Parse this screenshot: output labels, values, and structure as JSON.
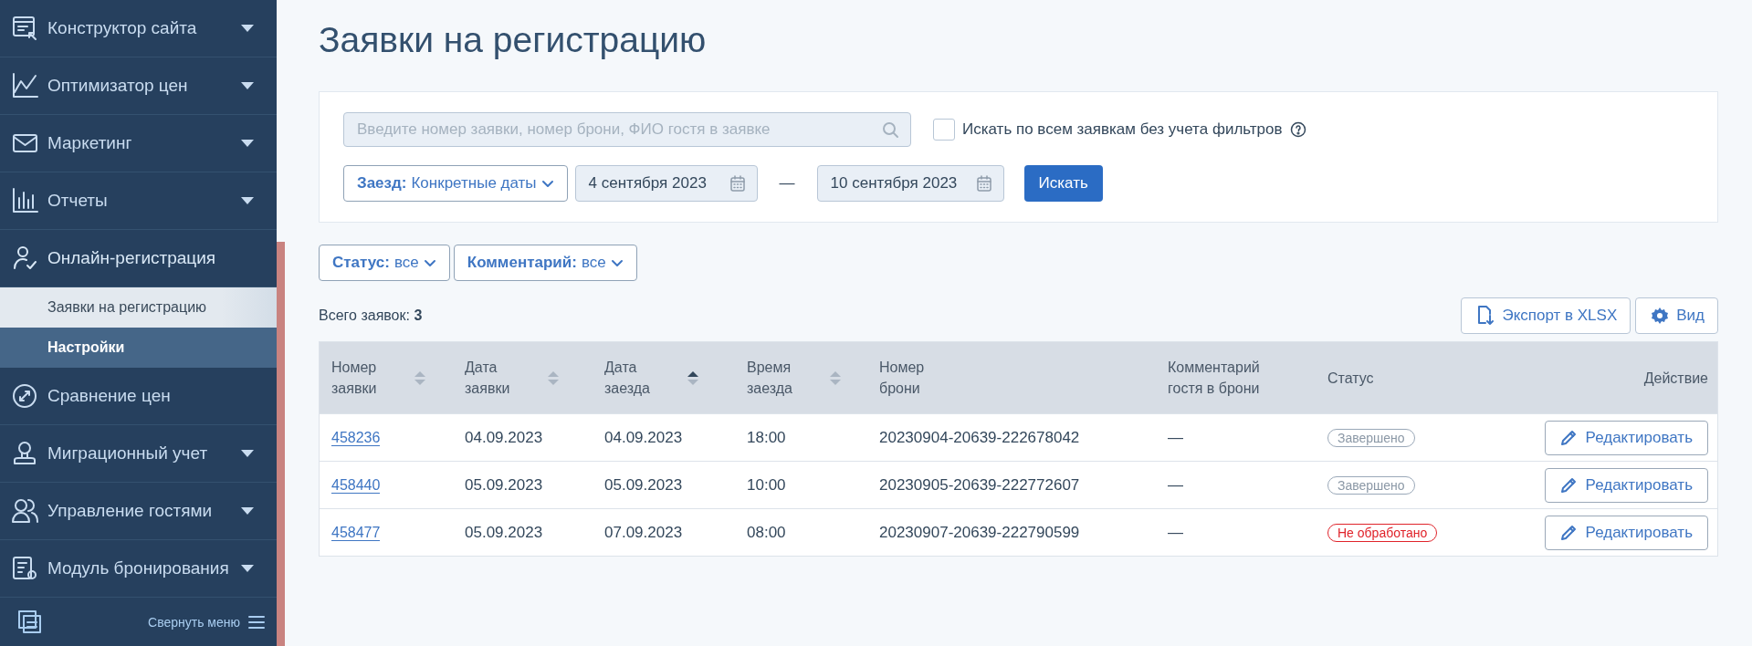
{
  "sidebar": {
    "items": [
      {
        "label": "Конструктор сайта",
        "kind": "group",
        "expanded": false
      },
      {
        "label": "Оптимизатор цен",
        "kind": "group",
        "expanded": false
      },
      {
        "label": "Маркетинг",
        "kind": "group",
        "expanded": false
      },
      {
        "label": "Отчеты",
        "kind": "group",
        "expanded": false
      },
      {
        "label": "Онлайн-регистрация",
        "kind": "group",
        "expanded": true,
        "children": [
          {
            "label": "Заявки на регистрацию",
            "selected": true,
            "highlighted": false
          },
          {
            "label": "Настройки",
            "selected": false,
            "highlighted": true
          }
        ]
      },
      {
        "label": "Сравнение цен",
        "kind": "link"
      },
      {
        "label": "Миграционный учет",
        "kind": "group",
        "expanded": false
      },
      {
        "label": "Управление гостями",
        "kind": "group",
        "expanded": false
      },
      {
        "label": "Модуль бронирования",
        "kind": "group",
        "expanded": false
      }
    ],
    "collapse_label": "Свернуть меню"
  },
  "page_title": "Заявки на регистрацию",
  "filters": {
    "search": {
      "placeholder": "Введите номер заявки, номер брони, ФИО гостя в заявке"
    },
    "search_all": {
      "label": "Искать по всем заявкам без учета фильтров",
      "checked": false
    },
    "date_type": {
      "label": "Заезд:",
      "value": "Конкретные даты"
    },
    "date_from": "4 сентября 2023",
    "date_separator": "—",
    "date_to": "10 сентября 2023",
    "search_button": "Искать"
  },
  "quick_filters": [
    {
      "label": "Статус:",
      "value": "все"
    },
    {
      "label": "Комментарий:",
      "value": "все"
    }
  ],
  "total": {
    "label": "Всего заявок:",
    "value": "3"
  },
  "actions": [
    {
      "label": "Экспорт в XLSX",
      "kind": "export"
    },
    {
      "label": "Вид",
      "kind": "view"
    }
  ],
  "table": {
    "columns": [
      {
        "label": "Номер заявки",
        "sortable": true,
        "sorted": false
      },
      {
        "label": "Дата заявки",
        "sortable": true,
        "sorted": false
      },
      {
        "label": "Дата заезда",
        "sortable": true,
        "sorted": true
      },
      {
        "label": "Время заезда",
        "sortable": true,
        "sorted": false
      },
      {
        "label": "Номер брони"
      },
      {
        "label": "Комментарий гостя в брони"
      },
      {
        "label": "Статус"
      },
      {
        "label": "Действие"
      }
    ],
    "rows": [
      {
        "number": "458236",
        "created": "04.09.2023",
        "arrival": "04.09.2023",
        "time": "18:00",
        "booking": "20230904-20639-222678042",
        "comment": "—",
        "status": "Завершено",
        "processed": true,
        "action": "Редактировать"
      },
      {
        "number": "458440",
        "created": "05.09.2023",
        "arrival": "05.09.2023",
        "time": "10:00",
        "booking": "20230905-20639-222772607",
        "comment": "—",
        "status": "Завершено",
        "processed": true,
        "action": "Редактировать"
      },
      {
        "number": "458477",
        "created": "05.09.2023",
        "arrival": "07.09.2023",
        "time": "08:00",
        "booking": "20230907-20639-222790599",
        "comment": "—",
        "status": "Не обработано",
        "processed": false,
        "action": "Редактировать"
      }
    ]
  }
}
